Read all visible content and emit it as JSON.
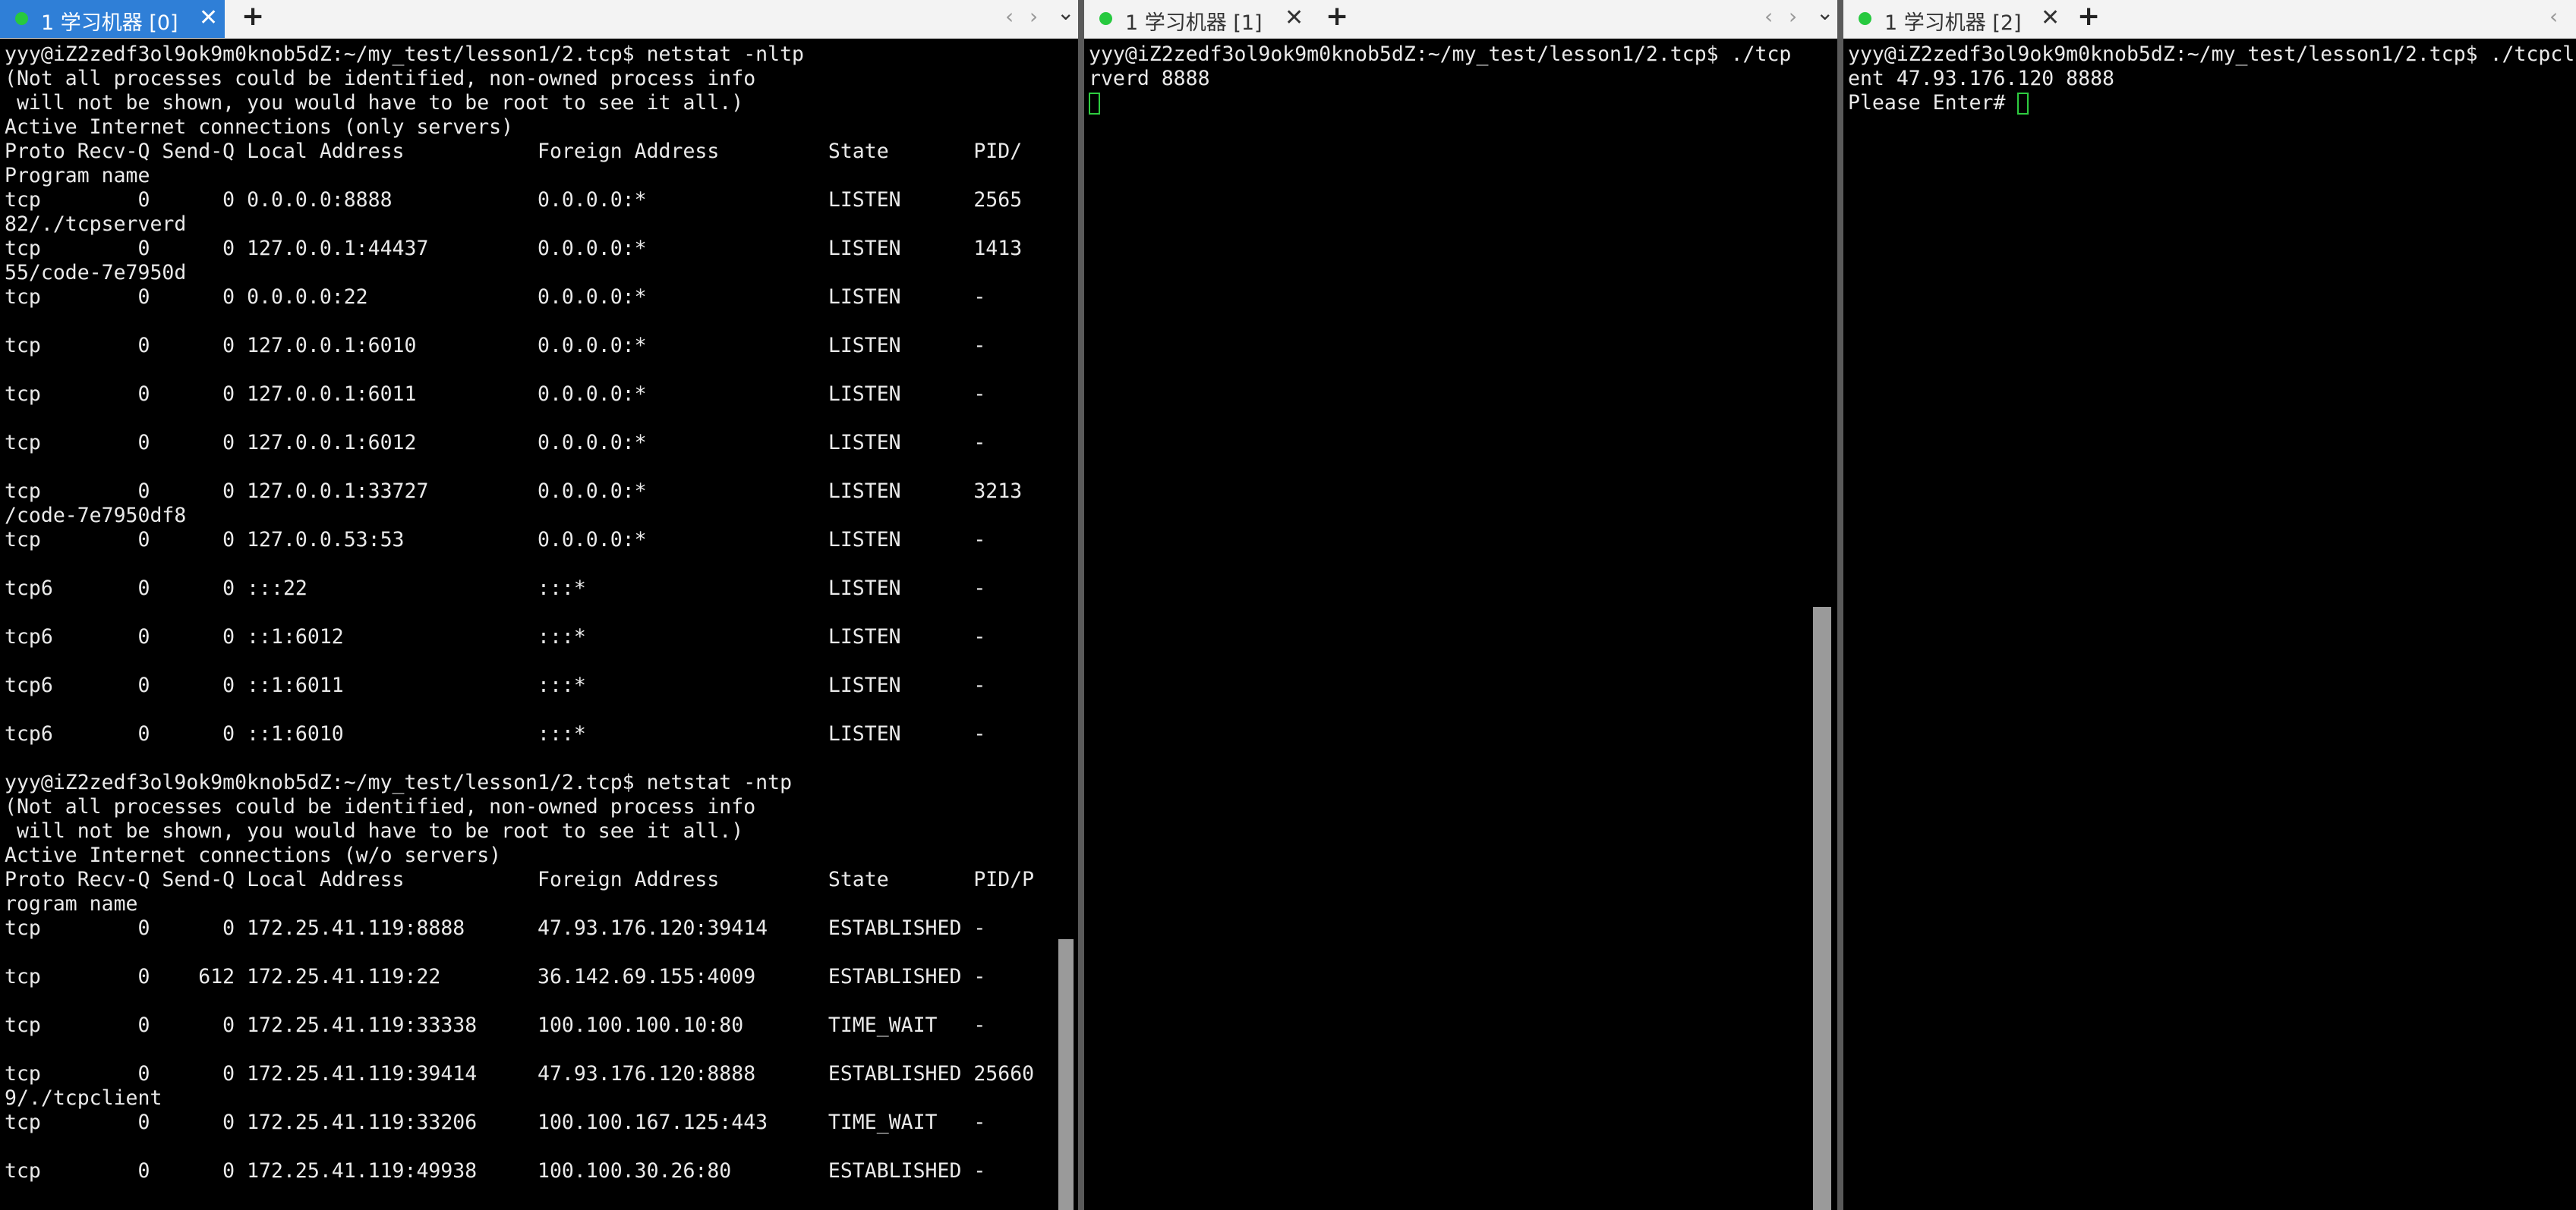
{
  "panes": [
    {
      "tab": {
        "label": "1 学习机器 [0]",
        "close": "✕",
        "active": true,
        "status_color": "#27c93f"
      },
      "lines": [
        "yyy@iZ2zedf3ol9ok9m0knob5dZ:~/my_test/lesson1/2.tcp$ netstat -nltp",
        "(Not all processes could be identified, non-owned process info",
        " will not be shown, you would have to be root to see it all.)",
        "Active Internet connections (only servers)",
        "Proto Recv-Q Send-Q Local Address           Foreign Address         State       PID/",
        "Program name",
        "tcp        0      0 0.0.0.0:8888            0.0.0.0:*               LISTEN      2565",
        "82/./tcpserverd",
        "tcp        0      0 127.0.0.1:44437         0.0.0.0:*               LISTEN      1413",
        "55/code-7e7950d",
        "tcp        0      0 0.0.0.0:22              0.0.0.0:*               LISTEN      -",
        "",
        "tcp        0      0 127.0.0.1:6010          0.0.0.0:*               LISTEN      -",
        "",
        "tcp        0      0 127.0.0.1:6011          0.0.0.0:*               LISTEN      -",
        "",
        "tcp        0      0 127.0.0.1:6012          0.0.0.0:*               LISTEN      -",
        "",
        "tcp        0      0 127.0.0.1:33727         0.0.0.0:*               LISTEN      3213",
        "/code-7e7950df8",
        "tcp        0      0 127.0.0.53:53           0.0.0.0:*               LISTEN      -",
        "",
        "tcp6       0      0 :::22                   :::*                    LISTEN      -",
        "",
        "tcp6       0      0 ::1:6012                :::*                    LISTEN      -",
        "",
        "tcp6       0      0 ::1:6011                :::*                    LISTEN      -",
        "",
        "tcp6       0      0 ::1:6010                :::*                    LISTEN      -",
        "",
        "yyy@iZ2zedf3ol9ok9m0knob5dZ:~/my_test/lesson1/2.tcp$ netstat -ntp",
        "(Not all processes could be identified, non-owned process info",
        " will not be shown, you would have to be root to see it all.)",
        "Active Internet connections (w/o servers)",
        "Proto Recv-Q Send-Q Local Address           Foreign Address         State       PID/P",
        "rogram name",
        "tcp        0      0 172.25.41.119:8888      47.93.176.120:39414     ESTABLISHED -",
        "",
        "tcp        0    612 172.25.41.119:22        36.142.69.155:4009      ESTABLISHED -",
        "",
        "tcp        0      0 172.25.41.119:33338     100.100.100.10:80       TIME_WAIT   -",
        "",
        "tcp        0      0 172.25.41.119:39414     47.93.176.120:8888      ESTABLISHED 25660",
        "9/./tcpclient",
        "tcp        0      0 172.25.41.119:33206     100.100.167.125:443     TIME_WAIT   -",
        "",
        "tcp        0      0 172.25.41.119:49938     100.100.30.26:80        ESTABLISHED -"
      ],
      "cursor": false
    },
    {
      "tab": {
        "label": "1 学习机器 [1]",
        "close": "✕",
        "active": false,
        "status_color": "#27c93f"
      },
      "lines": [
        "yyy@iZ2zedf3ol9ok9m0knob5dZ:~/my_test/lesson1/2.tcp$ ./tcp",
        "rverd 8888",
        ""
      ],
      "cursor": true
    },
    {
      "tab": {
        "label": "1 学习机器 [2]",
        "close": "✕",
        "active": false,
        "status_color": "#27c93f"
      },
      "lines": [
        "yyy@iZ2zedf3ol9ok9m0knob5dZ:~/my_test/lesson1/2.tcp$ ./tcpcli",
        "ent 47.93.176.120 8888",
        "Please Enter# "
      ],
      "cursor": true
    }
  ],
  "tabbar": {
    "new_tab": "+",
    "prev": "‹",
    "next": "›",
    "menu": "⌄"
  },
  "colors": {
    "active_tab": "#2f7fd7",
    "status_dot": "#27c93f",
    "cursor": "#2ecc40",
    "terminal_bg": "#000000",
    "terminal_fg": "#eaeaea"
  }
}
